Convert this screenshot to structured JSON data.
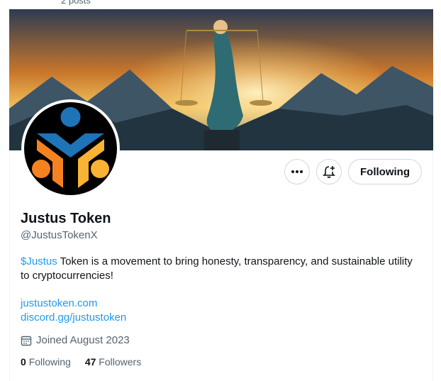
{
  "header": {
    "post_count": "2 posts"
  },
  "profile": {
    "name": "Justus Token",
    "handle": "@JustusTokenX",
    "bio_cashtag": "$Justus",
    "bio_text": " Token is a movement to bring honesty, transparency, and sustainable utility to cryptocurrencies!",
    "links": [
      "justustoken.com",
      "discord.gg/justustoken"
    ],
    "joined": "Joined August 2023",
    "following_count": "0",
    "following_label": "Following",
    "followers_count": "47",
    "followers_label": "Followers"
  },
  "actions": {
    "follow_label": "Following"
  },
  "icons": {
    "more": "more-icon",
    "notify": "bell-plus-icon",
    "calendar": "calendar-icon"
  },
  "colors": {
    "link": "#1d9bf0",
    "muted": "#536471",
    "text": "#0f1419",
    "logo_blue": "#1f73b7",
    "logo_orange": "#f58220",
    "logo_yellow": "#f9b233"
  }
}
